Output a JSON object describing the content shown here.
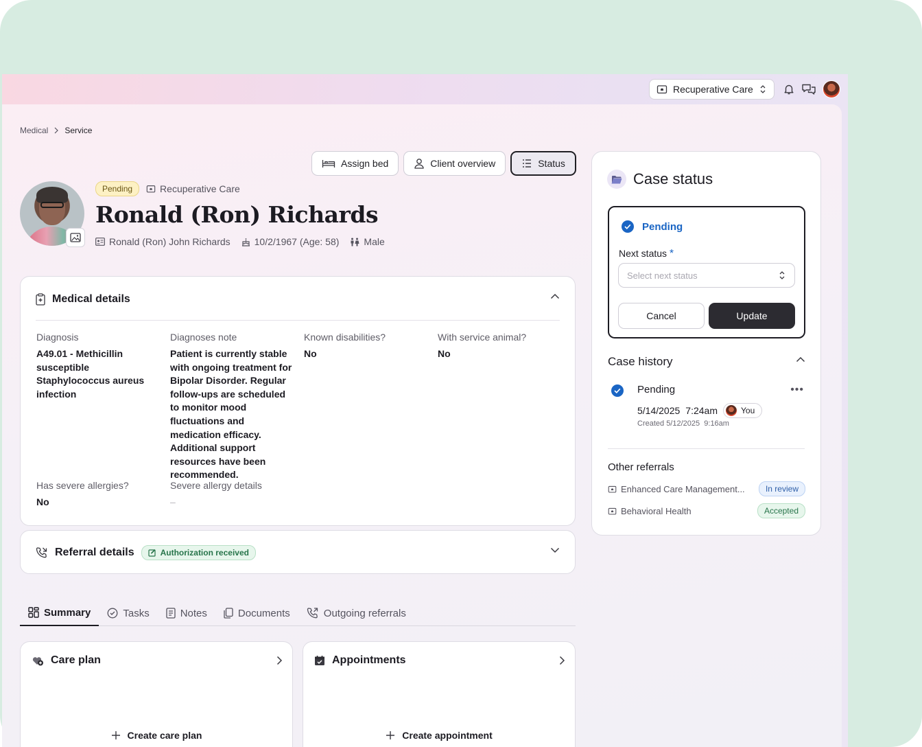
{
  "topbar": {
    "org_select": "Recuperative Care"
  },
  "breadcrumb": {
    "parent": "Medical",
    "current": "Service"
  },
  "actions": {
    "assign_bed": "Assign bed",
    "client_overview": "Client overview",
    "status": "Status"
  },
  "client": {
    "status_badge": "Pending",
    "program": "Recuperative Care",
    "display_name": "Ronald (Ron) Richards",
    "full_name": "Ronald (Ron) John Richards",
    "dob": "10/2/1967 (Age: 58)",
    "gender": "Male"
  },
  "medical": {
    "title": "Medical details",
    "fields": [
      {
        "label": "Diagnosis",
        "value": "A49.01 - Methicillin susceptible Staphylococcus aureus infection"
      },
      {
        "label": "Diagnoses note",
        "value": "Patient is currently stable with ongoing treatment for Bipolar Disorder. Regular follow-ups are scheduled to monitor mood fluctuations and medication efficacy. Additional support resources have been recommended."
      },
      {
        "label": "Known disabilities?",
        "value": "No"
      },
      {
        "label": "With service animal?",
        "value": "No"
      },
      {
        "label": "Has severe allergies?",
        "value": "No"
      },
      {
        "label": "Severe allergy details",
        "value": "–"
      }
    ]
  },
  "referral": {
    "title": "Referral details",
    "badge": "Authorization received"
  },
  "tabs": [
    {
      "label": "Summary"
    },
    {
      "label": "Tasks"
    },
    {
      "label": "Notes"
    },
    {
      "label": "Documents"
    },
    {
      "label": "Outgoing referrals"
    }
  ],
  "care_plan": {
    "title": "Care plan",
    "action": "Create care plan"
  },
  "appointments": {
    "title": "Appointments",
    "action": "Create appointment"
  },
  "case_status": {
    "title": "Case status",
    "current": "Pending",
    "next_label": "Next status",
    "required_mark": "*",
    "placeholder": "Select next status",
    "cancel": "Cancel",
    "update": "Update"
  },
  "case_history": {
    "title": "Case history",
    "item": {
      "status": "Pending",
      "date": "5/14/2025",
      "time": "7:24am",
      "user": "You",
      "created": "Created 5/12/2025",
      "created_time": "9:16am"
    }
  },
  "other_referrals": {
    "title": "Other referrals",
    "items": [
      {
        "name": "Enhanced Care Management...",
        "status": "In review"
      },
      {
        "name": "Behavioral Health",
        "status": "Accepted"
      }
    ]
  },
  "colors": {
    "accent_blue": "#1a65c4",
    "pending_badge": "#fdf1c4",
    "accepted_badge": "#e7f6ec",
    "review_badge": "#e9f1fd",
    "primary_button": "#2c2b31"
  }
}
